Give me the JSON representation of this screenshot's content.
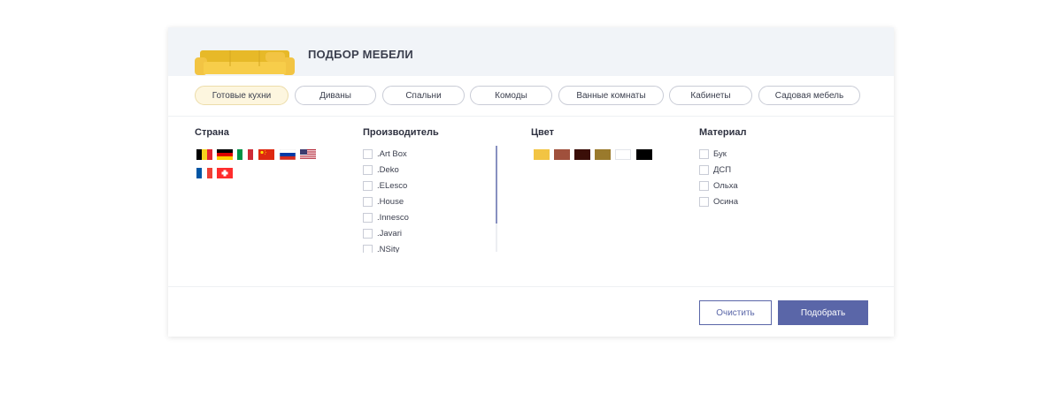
{
  "header": {
    "title": "ПОДБОР МЕБЕЛИ"
  },
  "tabs": [
    {
      "label": "Готовые кухни",
      "active": true
    },
    {
      "label": "Диваны"
    },
    {
      "label": "Спальни"
    },
    {
      "label": "Комоды"
    },
    {
      "label": "Ванные комнаты"
    },
    {
      "label": "Кабинеты"
    },
    {
      "label": "Садовая мебель"
    }
  ],
  "filters": {
    "country": {
      "title": "Страна",
      "flags": [
        "belgium-flag",
        "germany-flag",
        "italy-flag",
        "china-flag",
        "russia-flag",
        "usa-flag",
        "france-flag",
        "switzerland-flag"
      ]
    },
    "maker": {
      "title": "Производитель",
      "items": [
        ".Art Box",
        ".Deko",
        ".ELesco",
        ".House",
        ".Innesco",
        ".Javari",
        ".NSity"
      ]
    },
    "color": {
      "title": "Цвет",
      "swatches": [
        "#f2c443",
        "#a0503c",
        "#3a0e08",
        "#9a7a2c",
        "#ffffff",
        "#000000"
      ]
    },
    "material": {
      "title": "Материал",
      "items": [
        "Бук",
        "ДСП",
        "Ольха",
        "Осина"
      ]
    }
  },
  "buttons": {
    "clear": "Очистить",
    "submit": "Подобрать"
  },
  "colors": {
    "accent": "#5a66a8",
    "header_bg": "#f1f4f8",
    "active_tab_bg": "#fdf6df"
  }
}
